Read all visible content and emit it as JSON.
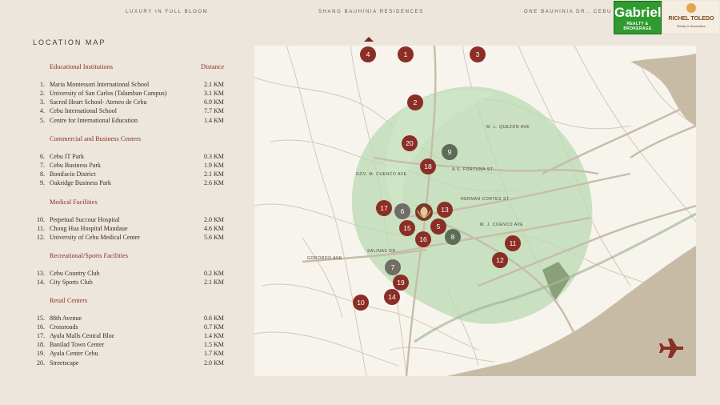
{
  "header": {
    "tagline_left": "LUXURY IN FULL BLOOM",
    "tagline_center": "SHANG BAUHINIA RESIDENCES",
    "tagline_right": "ONE BAUHINIA DR., CEBU",
    "logo_gabriel": {
      "name": "Gabriel",
      "subtitle": "REALTY & BROKERAGE"
    },
    "logo_richel": {
      "name": "RICHEL TOLEDO",
      "subtitle": "Realty & Associates"
    }
  },
  "page_title": "LOCATION MAP",
  "legend": {
    "distance_header": "Distance",
    "sections": [
      {
        "title": "Educational Institutions",
        "items": [
          {
            "num": "1.",
            "name": "Maria Montessori International School",
            "dist": "2.1 KM"
          },
          {
            "num": "2.",
            "name": "University of San Carlos (Talamban Campus)",
            "dist": "3.1 KM"
          },
          {
            "num": "3.",
            "name": "Sacred Heart School- Ateneo de Cebu",
            "dist": "6.9 KM"
          },
          {
            "num": "4.",
            "name": "Cebu International School",
            "dist": "7.7 KM"
          },
          {
            "num": "5.",
            "name": "Centre for International Education",
            "dist": "1.4 KM"
          }
        ]
      },
      {
        "title": "Commercial and Business Centers",
        "items": [
          {
            "num": "6.",
            "name": "Cebu IT Park",
            "dist": "0.3 KM"
          },
          {
            "num": "7.",
            "name": "Cebu Business Park",
            "dist": "1.9 KM"
          },
          {
            "num": "8.",
            "name": "Bonifacio District",
            "dist": "2.1 KM"
          },
          {
            "num": "9.",
            "name": "Oakridge Business Park",
            "dist": "2.6 KM"
          }
        ]
      },
      {
        "title": "Medical Facilities",
        "items": [
          {
            "num": "10.",
            "name": "Perpetual Succour Hospital",
            "dist": "2.0 KM"
          },
          {
            "num": "11.",
            "name": "Chong Hua Hospital Mandaue",
            "dist": "4.6 KM"
          },
          {
            "num": "12.",
            "name": "University of Cebu Medical Center",
            "dist": "5.6 KM"
          }
        ]
      },
      {
        "title": "Recreational/Sports Facilities",
        "items": [
          {
            "num": "13.",
            "name": "Cebu Country Club",
            "dist": "0.2 KM"
          },
          {
            "num": "14.",
            "name": "City Sports Club",
            "dist": "2.1 KM"
          }
        ]
      },
      {
        "title": "Retail Centers",
        "items": [
          {
            "num": "15.",
            "name": "88th Avenue",
            "dist": "0.6 KM"
          },
          {
            "num": "16.",
            "name": "Crossroads",
            "dist": "0.7 KM"
          },
          {
            "num": "17.",
            "name": "Ayala Malls Central Bloc",
            "dist": "1.4 KM"
          },
          {
            "num": "18.",
            "name": "Banilad Town Center",
            "dist": "1.5 KM"
          },
          {
            "num": "19.",
            "name": "Ayala Center Cebu",
            "dist": "1.7 KM"
          },
          {
            "num": "20.",
            "name": "Streetscape",
            "dist": "2.0 KM"
          }
        ]
      }
    ]
  },
  "map": {
    "road_labels": [
      "M. L. QUEZON AVE",
      "A.S. FORTUNA ST",
      "GOV. M. CUENCO AVE",
      "HERNAN CORTES ST",
      "M. J. CUENCO AVE",
      "GORORDO AVE",
      "SALINAS DR."
    ],
    "pins": [
      {
        "label": "1",
        "kind": "red"
      },
      {
        "label": "2",
        "kind": "red"
      },
      {
        "label": "3",
        "kind": "red"
      },
      {
        "label": "4",
        "kind": "red"
      },
      {
        "label": "5",
        "kind": "red"
      },
      {
        "label": "6",
        "kind": "gray"
      },
      {
        "label": "7",
        "kind": "gray"
      },
      {
        "label": "8",
        "kind": "green"
      },
      {
        "label": "9",
        "kind": "green"
      },
      {
        "label": "10",
        "kind": "red"
      },
      {
        "label": "11",
        "kind": "red"
      },
      {
        "label": "12",
        "kind": "red"
      },
      {
        "label": "13",
        "kind": "red"
      },
      {
        "label": "14",
        "kind": "red"
      },
      {
        "label": "15",
        "kind": "red"
      },
      {
        "label": "16",
        "kind": "red"
      },
      {
        "label": "17",
        "kind": "red"
      },
      {
        "label": "18",
        "kind": "red"
      },
      {
        "label": "19",
        "kind": "red"
      },
      {
        "label": "20",
        "kind": "red"
      }
    ],
    "colors": {
      "red": "#8a2e26",
      "dark_red": "#7a3a28",
      "gray": "#6f6d66",
      "green": "#5b6e55",
      "zone": "#b9dbb1",
      "sea": "#c8bba6",
      "land": "#f7f4ee",
      "road": "#d2c8b8"
    },
    "icons": [
      "bauhinia-logo-icon",
      "airplane-icon"
    ]
  }
}
